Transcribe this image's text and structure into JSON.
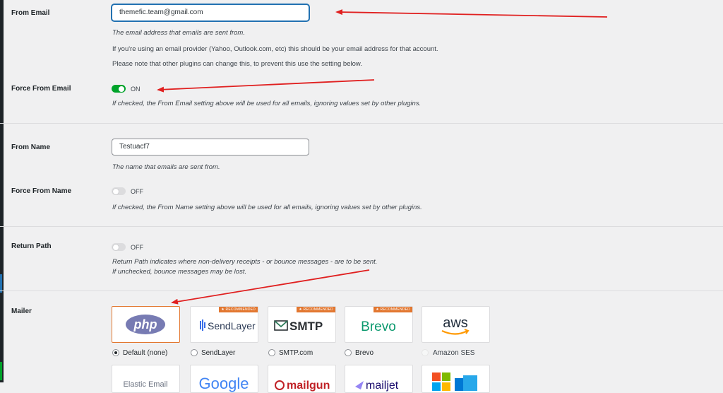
{
  "from_email": {
    "label": "From Email",
    "value": "themefic.team@gmail.com",
    "desc1": "The email address that emails are sent from.",
    "desc2": "If you're using an email provider (Yahoo, Outlook.com, etc) this should be your email address for that account.",
    "desc3": "Please note that other plugins can change this, to prevent this use the setting below."
  },
  "force_from_email": {
    "label": "Force From Email",
    "state": "ON",
    "desc": "If checked, the From Email setting above will be used for all emails, ignoring values set by other plugins."
  },
  "from_name": {
    "label": "From Name",
    "value": "Testuacf7",
    "desc": "The name that emails are sent from."
  },
  "force_from_name": {
    "label": "Force From Name",
    "state": "OFF",
    "desc": "If checked, the From Name setting above will be used for all emails, ignoring values set by other plugins."
  },
  "return_path": {
    "label": "Return Path",
    "state": "OFF",
    "desc1": "Return Path indicates where non-delivery receipts - or bounce messages - are to be sent.",
    "desc2": "If unchecked, bounce messages may be lost."
  },
  "mailer": {
    "label": "Mailer",
    "badge": "RECOMMENDED",
    "options": [
      {
        "logo": "php",
        "label": "Default (none)",
        "selected": true,
        "recommended": false
      },
      {
        "logo": "SendLayer",
        "label": "SendLayer",
        "selected": false,
        "recommended": true
      },
      {
        "logo": "SMTP",
        "label": "SMTP.com",
        "selected": false,
        "recommended": true
      },
      {
        "logo": "Brevo",
        "label": "Brevo",
        "selected": false,
        "recommended": true
      },
      {
        "logo": "aws",
        "label": "Amazon SES",
        "selected": false,
        "recommended": false,
        "disabled": true
      }
    ],
    "second_row_logos": [
      "Elastic Email",
      "Google",
      "mailgun",
      "mailjet",
      "Microsoft"
    ]
  },
  "colors": {
    "accent": "#2271b1",
    "toggle_on": "#00a32a",
    "selected_border": "#e27730",
    "annotation_arrow": "#e02020"
  }
}
